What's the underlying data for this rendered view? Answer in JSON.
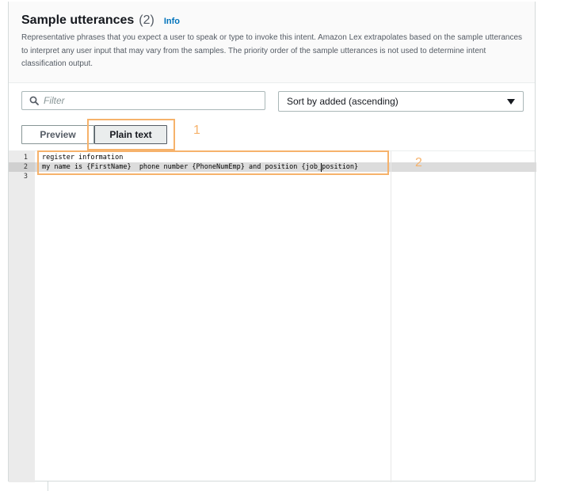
{
  "header": {
    "title": "Sample utterances",
    "count": "(2)",
    "info_link": "Info",
    "description": "Representative phrases that you expect a user to speak or type to invoke this intent. Amazon Lex extrapolates based on the sample utterances to interpret any user input that may vary from the samples. The priority order of the sample utterances is not used to determine intent classification output."
  },
  "filter": {
    "placeholder": "Filter",
    "value": ""
  },
  "sort": {
    "selected": "Sort by added (ascending)"
  },
  "tabs": [
    {
      "label": "Preview",
      "active": false
    },
    {
      "label": "Plain text",
      "active": true
    }
  ],
  "editor": {
    "line_numbers": [
      "1",
      "2",
      "3"
    ],
    "lines": [
      "register information",
      "my name is {FirstName}  phone number {PhoneNumEmp} and position {job_position}",
      ""
    ]
  },
  "annotations": [
    {
      "label": "1"
    },
    {
      "label": "2"
    }
  ],
  "colors": {
    "accent": "#0073bb",
    "annotation": "#f6b26b"
  },
  "icons": {
    "filter": "search-icon",
    "sort": "caret-down-icon"
  }
}
